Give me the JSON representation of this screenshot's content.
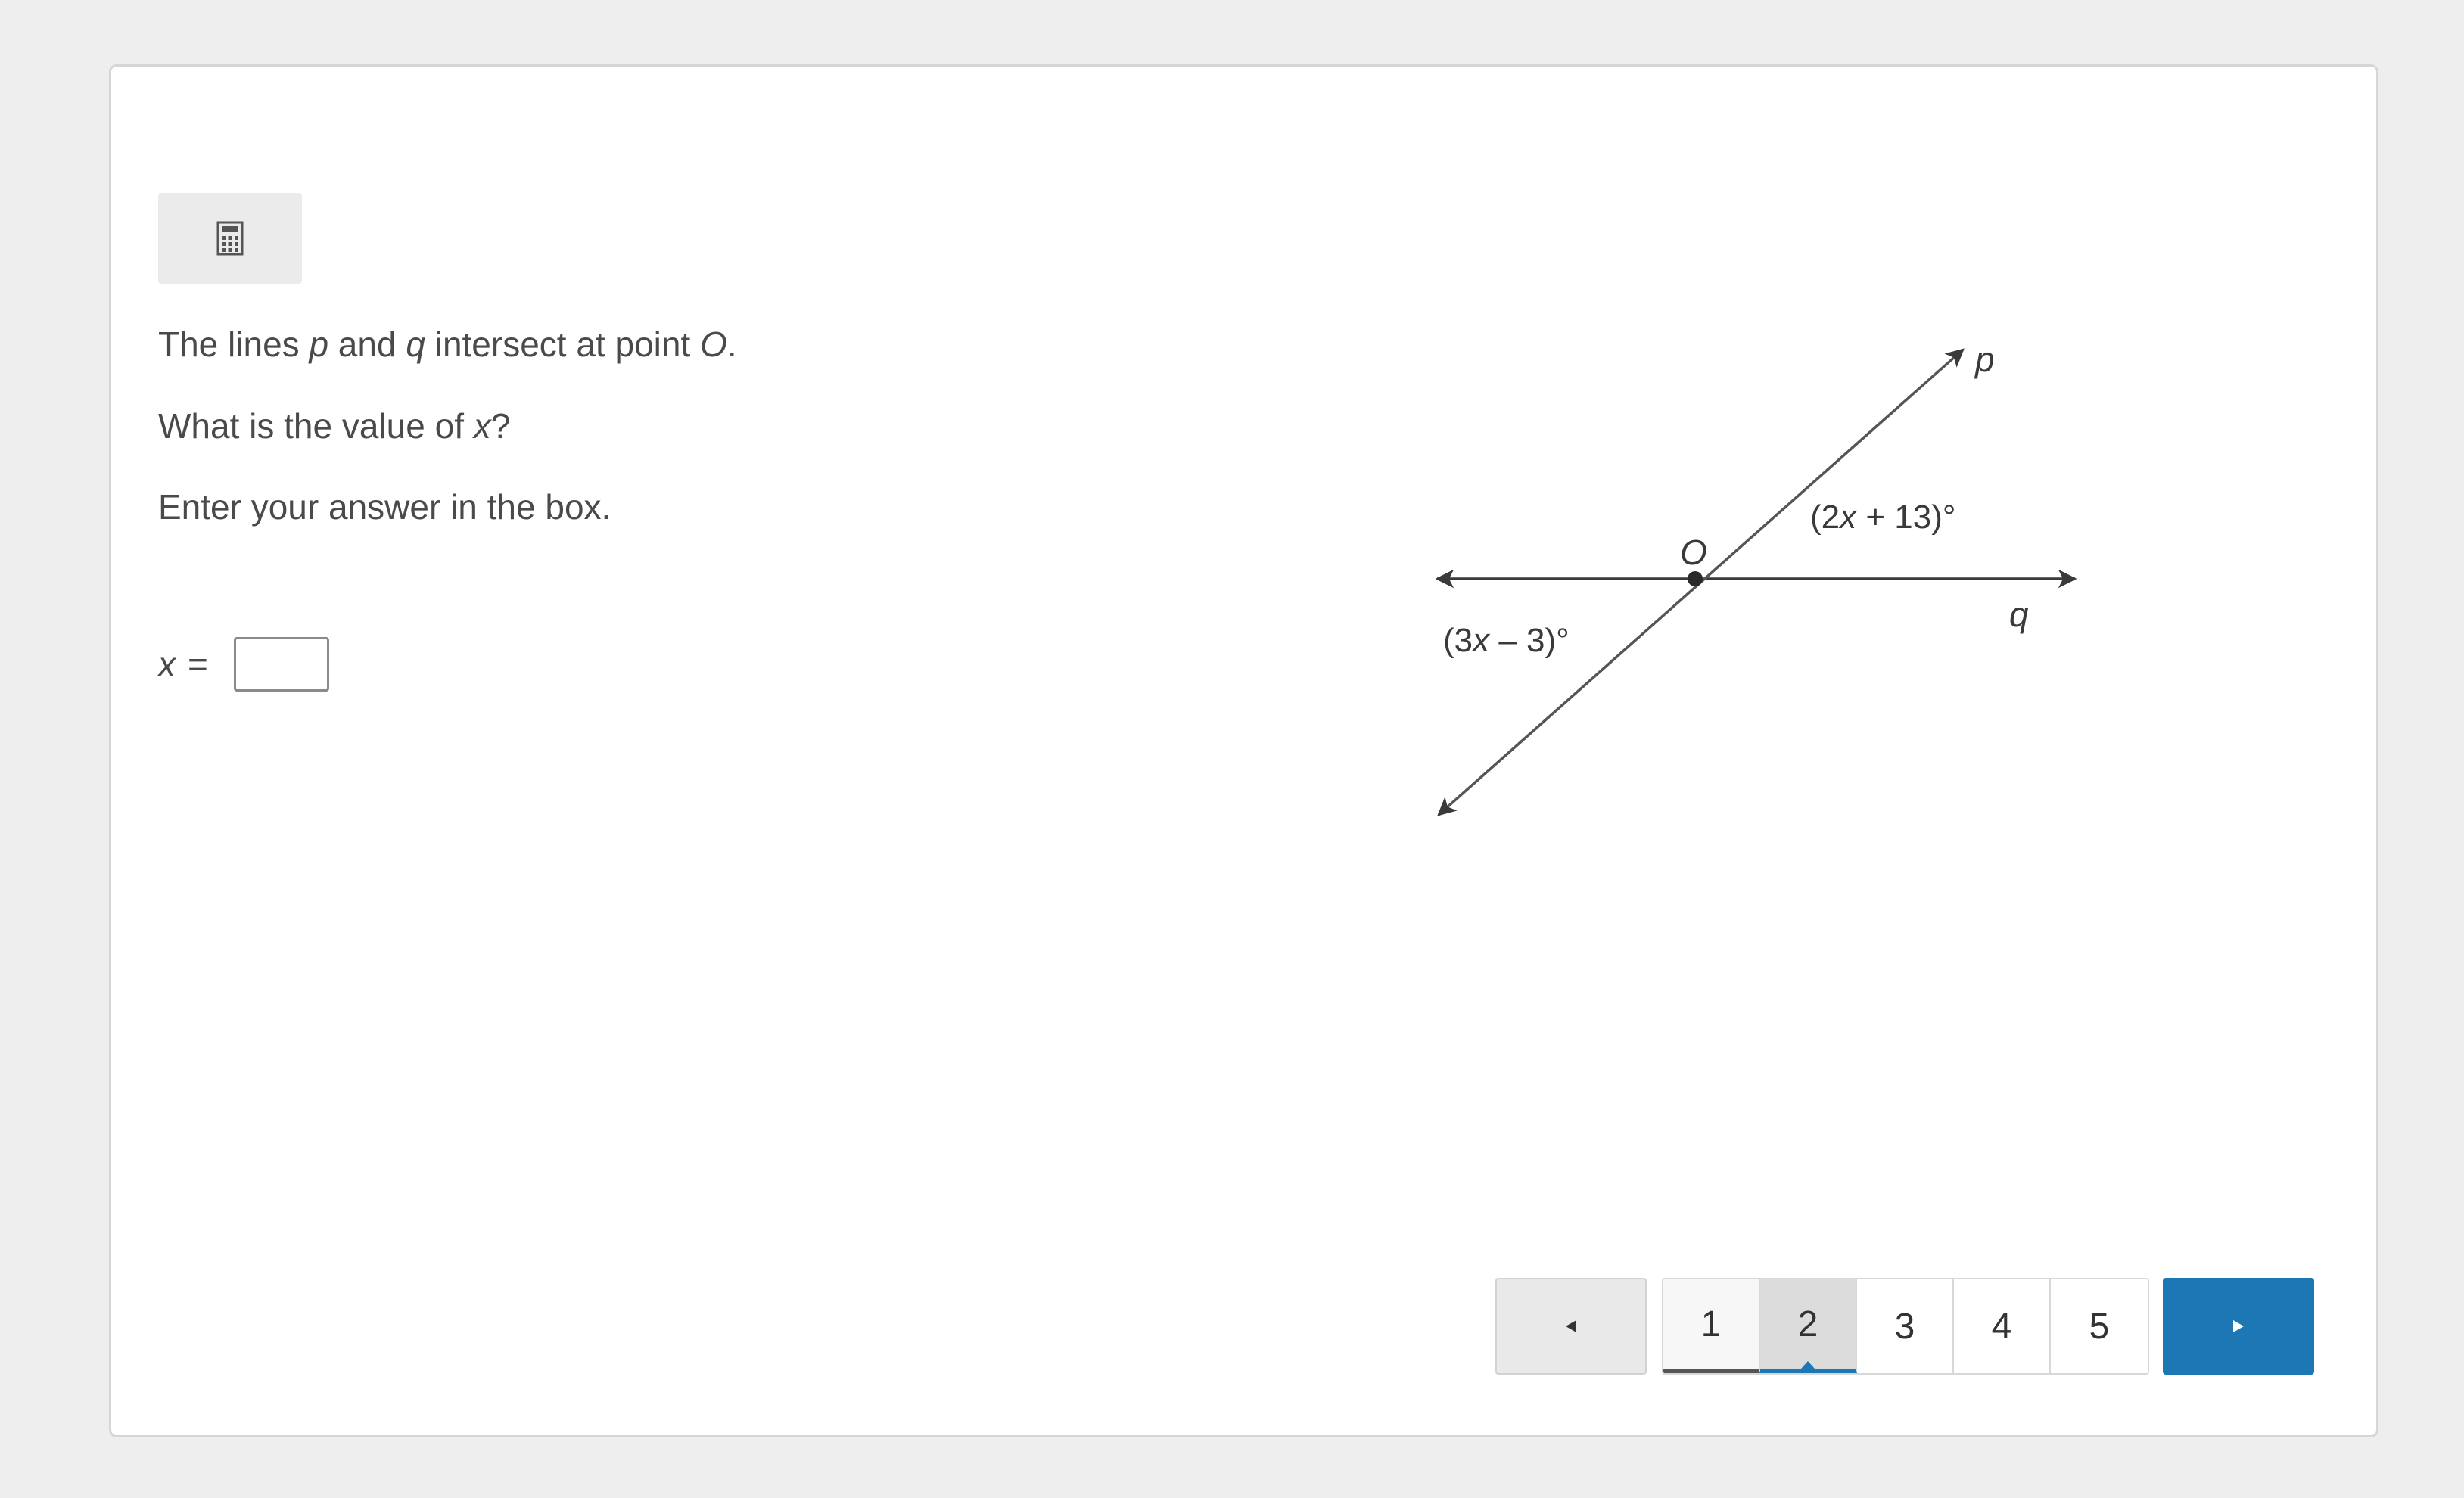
{
  "toolbar": {
    "calculator_icon": "calculator-icon"
  },
  "question": {
    "line1": {
      "t1": "The lines ",
      "p": "p",
      "t2": " and ",
      "q": "q",
      "t3": " intersect at point ",
      "o": "O",
      "t4": "."
    },
    "line2": {
      "t1": "What is the value of ",
      "x": "x",
      "t2": "?"
    },
    "line3": "Enter your answer in the box."
  },
  "answer": {
    "variable": "x",
    "equals": "=",
    "value": ""
  },
  "figure": {
    "line_p_label": "p",
    "line_q_label": "q",
    "point_label": "O",
    "angle_top": {
      "open": "(2",
      "var": "x",
      "close": " + 13)°"
    },
    "angle_bottom": {
      "open": "(3",
      "var": "x",
      "close": " – 3)°"
    }
  },
  "pagination": {
    "prev_icon": "triangle-left-icon",
    "next_icon": "triangle-right-icon",
    "pages": [
      "1",
      "2",
      "3",
      "4",
      "5"
    ],
    "current_page": "2",
    "accent_color": "#1e77b5"
  }
}
